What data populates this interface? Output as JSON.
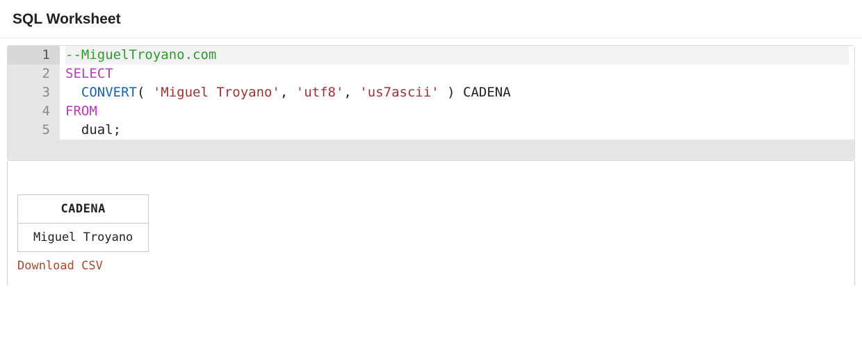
{
  "header": {
    "title": "SQL Worksheet"
  },
  "editor": {
    "lines": [
      {
        "n": "1",
        "tokens": [
          {
            "cls": "comment",
            "t": "--MiguelTroyano.com"
          }
        ]
      },
      {
        "n": "2",
        "tokens": [
          {
            "cls": "kw",
            "t": "SELECT"
          }
        ]
      },
      {
        "n": "3",
        "tokens": [
          {
            "cls": "plain",
            "t": "  "
          },
          {
            "cls": "fn",
            "t": "CONVERT"
          },
          {
            "cls": "plain",
            "t": "( "
          },
          {
            "cls": "str",
            "t": "'Miguel Troyano'"
          },
          {
            "cls": "plain",
            "t": ", "
          },
          {
            "cls": "str",
            "t": "'utf8'"
          },
          {
            "cls": "plain",
            "t": ", "
          },
          {
            "cls": "str",
            "t": "'us7ascii'"
          },
          {
            "cls": "plain",
            "t": " ) CADENA"
          }
        ]
      },
      {
        "n": "4",
        "tokens": [
          {
            "cls": "kw",
            "t": "FROM"
          }
        ]
      },
      {
        "n": "5",
        "tokens": [
          {
            "cls": "plain",
            "t": "  dual;"
          }
        ]
      }
    ],
    "highlight_line": 1
  },
  "results": {
    "columns": [
      "CADENA"
    ],
    "rows": [
      [
        "Miguel Troyano"
      ]
    ],
    "download_label": "Download CSV"
  }
}
